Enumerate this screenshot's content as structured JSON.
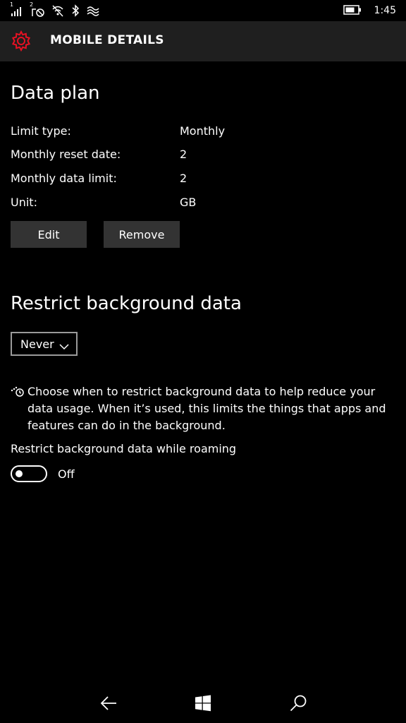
{
  "status_bar": {
    "sim1_label": "1",
    "sim2_label": "2",
    "time": "1:45",
    "icons": [
      "signal-icon",
      "sim2-no-service-icon",
      "wifi-off-icon",
      "bluetooth-icon",
      "data-sense-icon",
      "battery-icon"
    ]
  },
  "header": {
    "icon": "gear-icon",
    "title": "MOBILE DETAILS",
    "accent_color": "#e81123"
  },
  "data_plan": {
    "title": "Data plan",
    "rows": [
      {
        "label": "Limit type:",
        "value": "Monthly"
      },
      {
        "label": "Monthly reset date:",
        "value": "2"
      },
      {
        "label": "Monthly data limit:",
        "value": "2"
      },
      {
        "label": "Unit:",
        "value": "GB"
      }
    ],
    "edit_label": "Edit",
    "remove_label": "Remove"
  },
  "restrict": {
    "title": "Restrict background data",
    "dropdown_value": "Never",
    "info_icon": "data-saver-icon",
    "info_text": "Choose when to restrict background data to help reduce your data usage. When it’s used, this limits the things that apps and features can do in the background.",
    "roaming_label": "Restrict background data while roaming",
    "roaming_toggle_state": "Off"
  },
  "nav_bar": {
    "icons": [
      "back-arrow-icon",
      "windows-icon",
      "search-icon"
    ]
  }
}
